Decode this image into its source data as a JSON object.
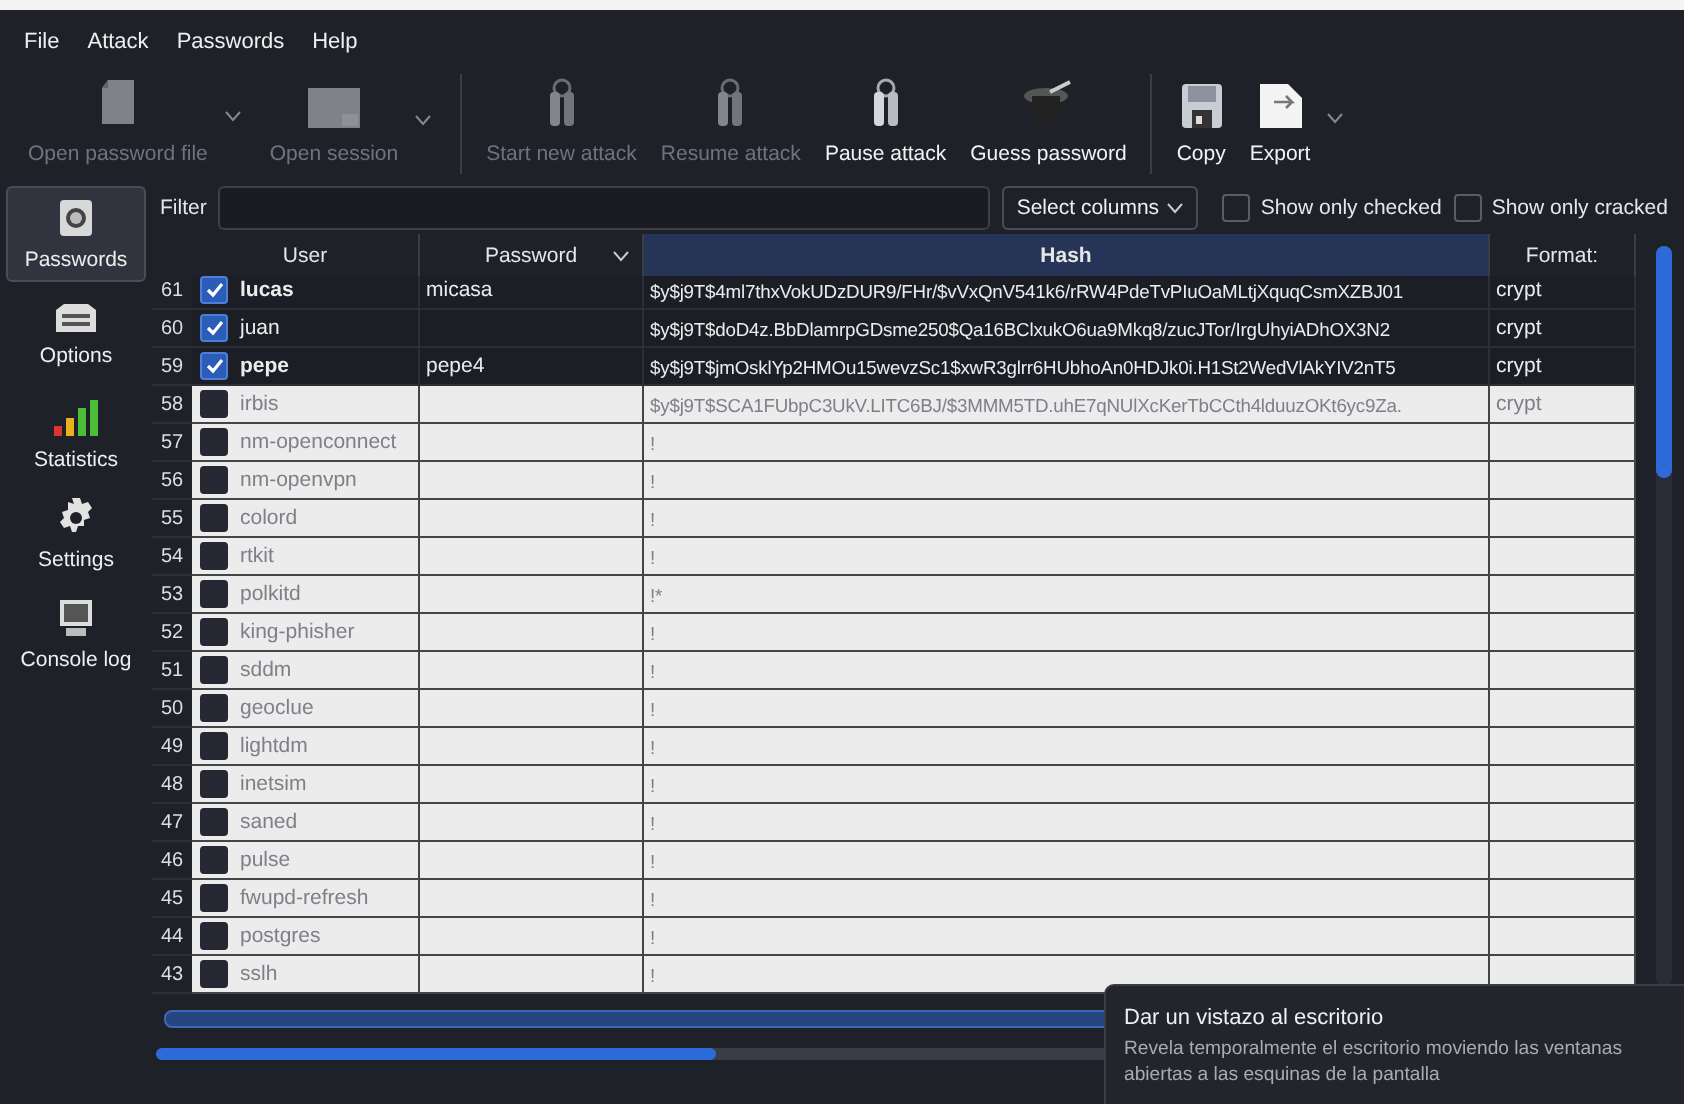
{
  "menu": [
    "File",
    "Attack",
    "Passwords",
    "Help"
  ],
  "toolbar": [
    {
      "kind": "button",
      "label": "Open password file",
      "disabled": true,
      "dropdown": true
    },
    {
      "kind": "button",
      "label": "Open session",
      "disabled": true,
      "dropdown": true
    },
    {
      "kind": "separator"
    },
    {
      "kind": "button",
      "label": "Start new attack",
      "disabled": true,
      "dropdown": false
    },
    {
      "kind": "button",
      "label": "Resume attack",
      "disabled": true,
      "dropdown": false
    },
    {
      "kind": "button",
      "label": "Pause attack",
      "disabled": false,
      "dropdown": false
    },
    {
      "kind": "button",
      "label": "Guess password",
      "disabled": false,
      "dropdown": false
    },
    {
      "kind": "separator"
    },
    {
      "kind": "button",
      "label": "Copy",
      "disabled": false,
      "dropdown": false
    },
    {
      "kind": "button",
      "label": "Export",
      "disabled": false,
      "dropdown": true
    }
  ],
  "sidebar": [
    {
      "label": "Passwords",
      "selected": true
    },
    {
      "label": "Options",
      "selected": false
    },
    {
      "label": "Statistics",
      "selected": false
    },
    {
      "label": "Settings",
      "selected": false
    },
    {
      "label": "Console log",
      "selected": false
    }
  ],
  "filter": {
    "label": "Filter",
    "select_columns": "Select columns",
    "show_only_checked": false,
    "show_only_checked_label": "Show only checked",
    "show_only_cracked": false,
    "show_only_cracked_label": "Show only cracked"
  },
  "table": {
    "columns": [
      {
        "label": "User",
        "selected": false,
        "sort": false
      },
      {
        "label": "Password",
        "selected": false,
        "sort": true
      },
      {
        "label": "Hash",
        "selected": true,
        "sort": false
      },
      {
        "label": "Format:",
        "selected": false,
        "sort": false
      }
    ],
    "rows": [
      {
        "num": "61",
        "checked": true,
        "user": "lucas",
        "password": "micasa",
        "hash": "$y$j9T$4ml7thxVokUDzDUR9/FHr/$vVxQnV541k6/rRW4PdeTvPIuOaMLtjXquqCsmXZBJ01",
        "format": "crypt"
      },
      {
        "num": "60",
        "checked": true,
        "user": "juan",
        "password": "",
        "hash": "$y$j9T$doD4z.BbDlamrpGDsme250$Qa16BClxukO6ua9Mkq8/zucJTor/IrgUhyiADhOX3N2",
        "format": "crypt"
      },
      {
        "num": "59",
        "checked": true,
        "user": "pepe",
        "password": "pepe4",
        "hash": "$y$j9T$jmOsklYp2HMOu15wevzSc1$xwR3glrr6HUbhoAn0HDJk0i.H1St2WedVlAkYIV2nT5",
        "format": "crypt"
      },
      {
        "num": "58",
        "checked": false,
        "user": "irbis",
        "password": "",
        "hash": "$y$j9T$SCA1FUbpC3UkV.LITC6BJ/$3MMM5TD.uhE7qNUlXcKerTbCCth4lduuzOKt6yc9Za.",
        "format": "crypt"
      },
      {
        "num": "57",
        "checked": false,
        "user": "nm-openconnect",
        "password": "",
        "hash": "!",
        "format": ""
      },
      {
        "num": "56",
        "checked": false,
        "user": "nm-openvpn",
        "password": "",
        "hash": "!",
        "format": ""
      },
      {
        "num": "55",
        "checked": false,
        "user": "colord",
        "password": "",
        "hash": "!",
        "format": ""
      },
      {
        "num": "54",
        "checked": false,
        "user": "rtkit",
        "password": "",
        "hash": "!",
        "format": ""
      },
      {
        "num": "53",
        "checked": false,
        "user": "polkitd",
        "password": "",
        "hash": "!*",
        "format": ""
      },
      {
        "num": "52",
        "checked": false,
        "user": "king-phisher",
        "password": "",
        "hash": "!",
        "format": ""
      },
      {
        "num": "51",
        "checked": false,
        "user": "sddm",
        "password": "",
        "hash": "!",
        "format": ""
      },
      {
        "num": "50",
        "checked": false,
        "user": "geoclue",
        "password": "",
        "hash": "!",
        "format": ""
      },
      {
        "num": "49",
        "checked": false,
        "user": "lightdm",
        "password": "",
        "hash": "!",
        "format": ""
      },
      {
        "num": "48",
        "checked": false,
        "user": "inetsim",
        "password": "",
        "hash": "!",
        "format": ""
      },
      {
        "num": "47",
        "checked": false,
        "user": "saned",
        "password": "",
        "hash": "!",
        "format": ""
      },
      {
        "num": "46",
        "checked": false,
        "user": "pulse",
        "password": "",
        "hash": "!",
        "format": ""
      },
      {
        "num": "45",
        "checked": false,
        "user": "fwupd-refresh",
        "password": "",
        "hash": "!",
        "format": ""
      },
      {
        "num": "44",
        "checked": false,
        "user": "postgres",
        "password": "",
        "hash": "!",
        "format": ""
      },
      {
        "num": "43",
        "checked": false,
        "user": "sslh",
        "password": "",
        "hash": "!",
        "format": ""
      }
    ]
  },
  "progress": {
    "level": 0.37
  },
  "tooltip": {
    "title": "Dar un vistazo al escritorio",
    "body": "Revela temporalmente el escritorio moviendo las ventanas abiertas a las esquinas de la pantalla"
  }
}
